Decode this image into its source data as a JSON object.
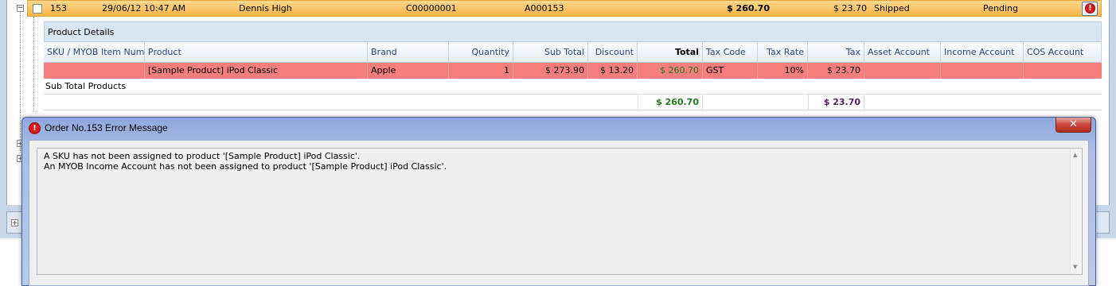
{
  "order": {
    "number": "153",
    "datetime": "29/06/12 10:47 AM",
    "customer": "Dennis High",
    "customer_id": "C00000001",
    "invoice": "A000153",
    "total": "$ 260.70",
    "tax": "$ 23.70",
    "status": "Shipped",
    "sync_status": "Pending",
    "error_glyph": "!",
    "expand_glyph": "−"
  },
  "details": {
    "caption": "Product Details",
    "headers": {
      "sku": "SKU / MYOB Item Num",
      "product": "Product",
      "brand": "Brand",
      "quantity": "Quantity",
      "subtotal": "Sub Total",
      "discount": "Discount",
      "total": "Total",
      "tax_code": "Tax Code",
      "tax_rate": "Tax Rate",
      "tax": "Tax",
      "asset_account": "Asset Account",
      "income_account": "Income Account",
      "cos_account": "COS Account"
    },
    "row": {
      "sku": "",
      "product": "[Sample Product] iPod Classic",
      "brand": "Apple",
      "quantity": "1",
      "subtotal": "$ 273.90",
      "discount": "$ 13.20",
      "total": "$ 260.70",
      "tax_code": "GST",
      "tax_rate": "10%",
      "tax": "$ 23.70",
      "asset_account": "",
      "income_account": "",
      "cos_account": ""
    },
    "subtotal_label": "Sub Total Products",
    "totals": {
      "total": "$ 260.70",
      "tax": "$ 23.70"
    }
  },
  "dialog": {
    "title": "Order No.153 Error Message",
    "icon_glyph": "!",
    "close_glyph": "✕",
    "messages": [
      "A SKU has not been assigned to product '[Sample Product] iPod Classic'.",
      "An MYOB Income Account has not been assigned to product '[Sample Product] iPod Classic'."
    ]
  },
  "colors": {
    "order_row": "#f6b546",
    "error_row": "#f67e7e",
    "total_green": "#1f7a1f",
    "tax_purple": "#4b1f56",
    "dialog_frame": "#a9bde8"
  }
}
